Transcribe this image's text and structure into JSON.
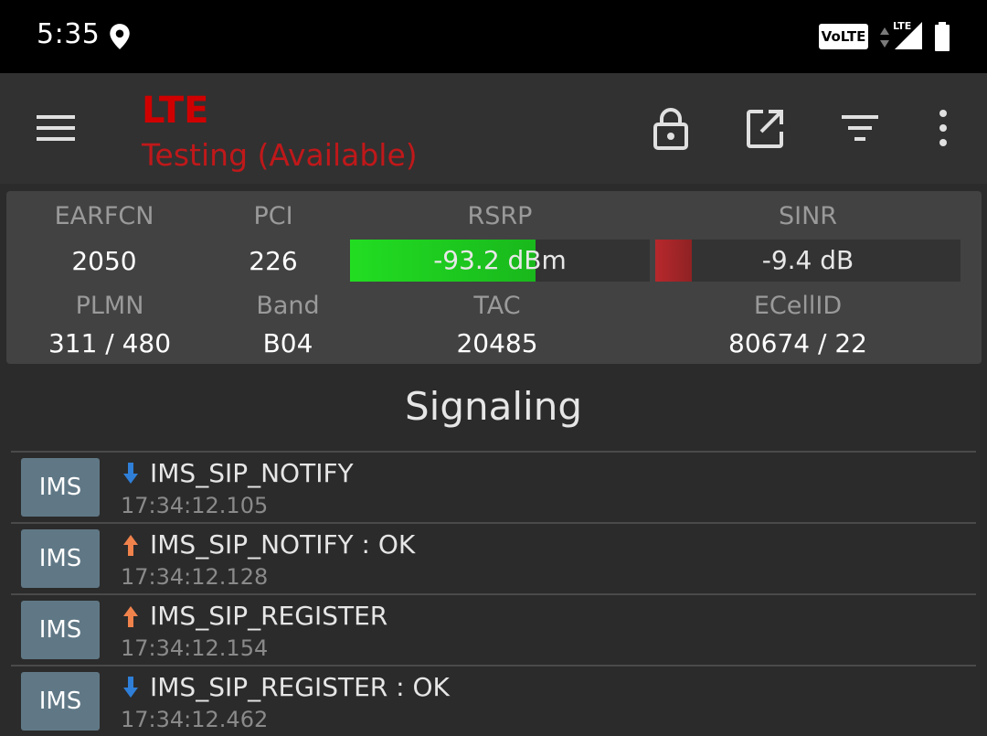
{
  "status_bar": {
    "time": "5:35",
    "volte": "VoLTE",
    "network": "LTE",
    "icons": [
      "location-icon",
      "data-arrows-icon",
      "signal-icon",
      "battery-icon"
    ]
  },
  "app_bar": {
    "title": "LTE",
    "subtitle": "Testing (Available)",
    "actions": [
      "menu-icon",
      "lock-icon",
      "open-external-icon",
      "filter-icon",
      "more-vert-icon"
    ],
    "accent_color": "#d00000"
  },
  "cell_info": {
    "earfcn": {
      "label": "EARFCN",
      "value": "2050"
    },
    "pci": {
      "label": "PCI",
      "value": "226"
    },
    "rsrp": {
      "label": "RSRP",
      "value": "-93.2 dBm",
      "level": 0.62,
      "color": "#22dd22"
    },
    "sinr": {
      "label": "SINR",
      "value": "-9.4 dB",
      "level": 0.12,
      "color": "#b8282c"
    },
    "plmn": {
      "label": "PLMN",
      "value": "311 / 480"
    },
    "band": {
      "label": "Band",
      "value": "B04"
    },
    "tac": {
      "label": "TAC",
      "value": "20485"
    },
    "ecellid": {
      "label": "ECellID",
      "value": "80674 / 22"
    }
  },
  "signaling": {
    "title": "Signaling",
    "items": [
      {
        "type": "IMS",
        "direction": "down",
        "name": "IMS_SIP_NOTIFY",
        "time": "17:34:12.105"
      },
      {
        "type": "IMS",
        "direction": "up",
        "name": "IMS_SIP_NOTIFY : OK",
        "time": "17:34:12.128"
      },
      {
        "type": "IMS",
        "direction": "up",
        "name": "IMS_SIP_REGISTER",
        "time": "17:34:12.154"
      },
      {
        "type": "IMS",
        "direction": "down",
        "name": "IMS_SIP_REGISTER : OK",
        "time": "17:34:12.462"
      }
    ],
    "colors": {
      "up": "#f0824c",
      "down": "#2f7fd8"
    }
  }
}
